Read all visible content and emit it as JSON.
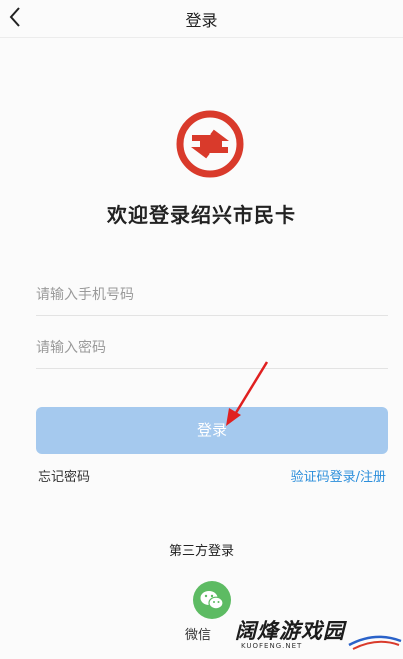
{
  "header": {
    "title": "登录",
    "back_icon": "chevron-left-icon"
  },
  "logo": {
    "icon": "shaoxing-citizen-card-logo",
    "color": "#d93a2b"
  },
  "welcome_text": "欢迎登录绍兴市民卡",
  "form": {
    "phone_placeholder": "请输入手机号码",
    "phone_value": "",
    "password_placeholder": "请输入密码",
    "password_value": ""
  },
  "login_button": {
    "label": "登录",
    "color": "#a5c9ee"
  },
  "links": {
    "forgot_password": "忘记密码",
    "sms_login_register": "验证码登录/注册",
    "link_color": "#2d8fdb"
  },
  "third_party": {
    "title": "第三方登录",
    "wechat_label": "微信",
    "wechat_icon": "wechat-icon",
    "wechat_color": "#5dbb63"
  },
  "annotation": {
    "arrow_icon": "red-arrow-icon",
    "color": "#e02020"
  },
  "watermark": {
    "text": "阔烽游戏园",
    "subtext": "KUOFENG.NET"
  }
}
